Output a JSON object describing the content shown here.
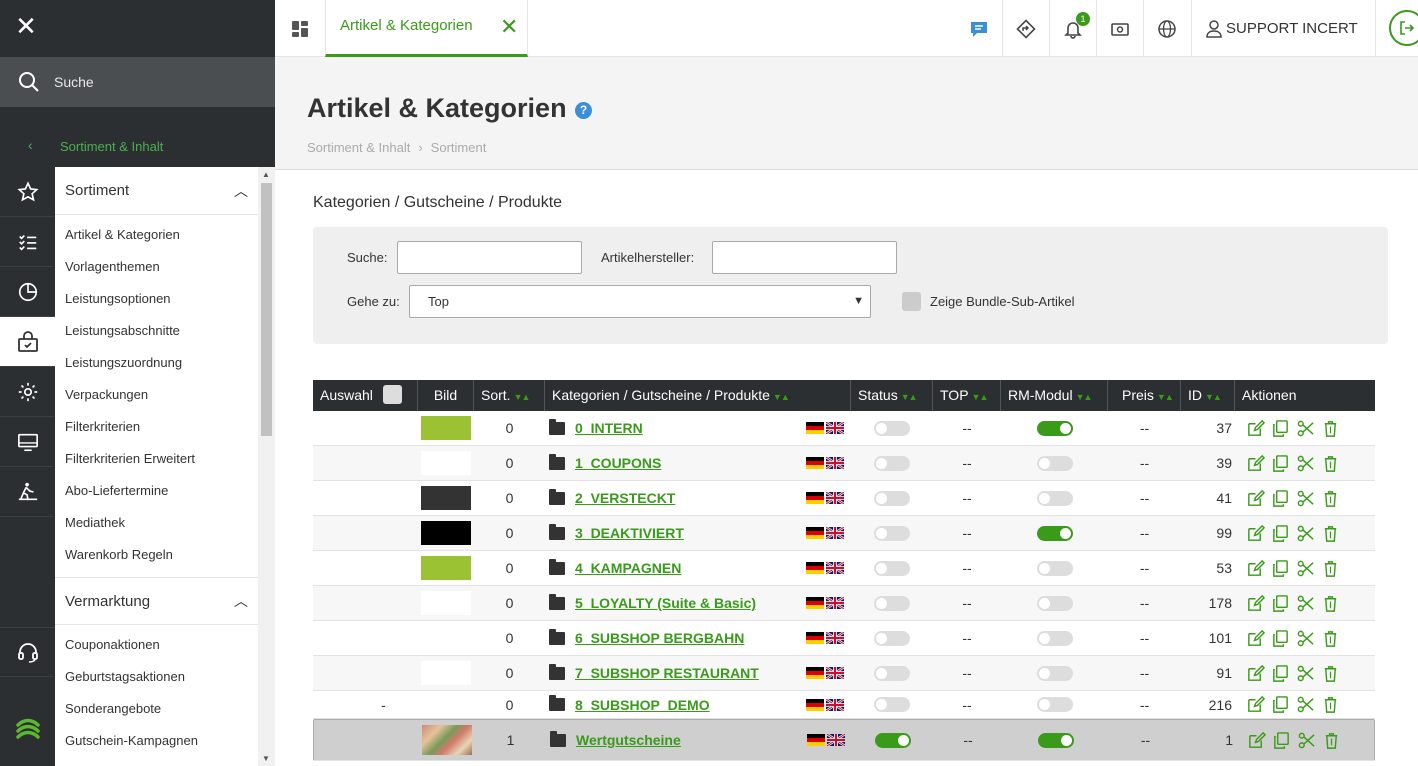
{
  "sidebar": {
    "search_label": "Suche",
    "section_label": "Sortiment & Inhalt",
    "rail_icons": [
      "star-icon",
      "checklist-icon",
      "pie-chart-icon",
      "shop-icon",
      "gear-icon",
      "monitor-icon",
      "hiker-icon",
      "headset-icon",
      "brand-logo-icon"
    ],
    "groups": [
      {
        "title": "Sortiment",
        "items": [
          "Artikel & Kategorien",
          "Vorlagenthemen",
          "Leistungsoptionen",
          "Leistungsabschnitte",
          "Leistungszuordnung",
          "Verpackungen",
          "Filterkriterien",
          "Filterkriterien Erweitert",
          "Abo-Liefertermine",
          "Mediathek",
          "Warenkorb Regeln"
        ]
      },
      {
        "title": "Vermarktung",
        "items": [
          "Couponaktionen",
          "Geburtstagsaktionen",
          "Sonderangebote",
          "Gutschein-Kampagnen"
        ]
      }
    ]
  },
  "topbar": {
    "tab_label": "Artikel & Kategorien",
    "notification_count": "1",
    "user_label": "SUPPORT INCERT"
  },
  "page": {
    "title": "Artikel & Kategorien",
    "help_glyph": "?",
    "breadcrumb": [
      "Sortiment & Inhalt",
      "Sortiment"
    ],
    "content_title": "Kategorien / Gutscheine / Produkte"
  },
  "filter": {
    "search_label": "Suche:",
    "search_value": "",
    "manufacturer_label": "Artikelhersteller:",
    "manufacturer_value": "",
    "goto_label": "Gehe zu:",
    "goto_value": "Top",
    "bundle_label": "Zeige Bundle-Sub-Artikel"
  },
  "table": {
    "headers": {
      "select": "Auswahl",
      "image": "Bild",
      "sort": "Sort.",
      "name": "Kategorien / Gutscheine / Produkte",
      "status": "Status",
      "top": "TOP",
      "rm": "RM-Modul",
      "price": "Preis",
      "id": "ID",
      "actions": "Aktionen"
    },
    "rows": [
      {
        "select": "",
        "image_color": "#9bc232",
        "sort": "0",
        "name": "0_INTERN",
        "status_on": false,
        "top": "--",
        "rm_on": true,
        "price": "--",
        "id": "37"
      },
      {
        "select": "",
        "image_color": "#ffffff",
        "sort": "0",
        "name": "1_COUPONS",
        "status_on": false,
        "top": "--",
        "rm_on": false,
        "price": "--",
        "id": "39"
      },
      {
        "select": "",
        "image_color": "#333333",
        "sort": "0",
        "name": "2_VERSTECKT",
        "status_on": false,
        "top": "--",
        "rm_on": false,
        "price": "--",
        "id": "41"
      },
      {
        "select": "",
        "image_color": "#000000",
        "sort": "0",
        "name": "3_DEAKTIVIERT",
        "status_on": false,
        "top": "--",
        "rm_on": true,
        "price": "--",
        "id": "99"
      },
      {
        "select": "",
        "image_color": "#9bc232",
        "sort": "0",
        "name": "4_KAMPAGNEN",
        "status_on": false,
        "top": "--",
        "rm_on": false,
        "price": "--",
        "id": "53"
      },
      {
        "select": "",
        "image_color": "#ffffff",
        "sort": "0",
        "name": "5_LOYALTY (Suite & Basic)",
        "status_on": false,
        "top": "--",
        "rm_on": false,
        "price": "--",
        "id": "178"
      },
      {
        "select": "",
        "image_color": "",
        "sort": "0",
        "name": "6_SUBSHOP BERGBAHN",
        "status_on": false,
        "top": "--",
        "rm_on": false,
        "price": "--",
        "id": "101"
      },
      {
        "select": "",
        "image_color": "#ffffff",
        "sort": "0",
        "name": "7_SUBSHOP RESTAURANT",
        "status_on": false,
        "top": "--",
        "rm_on": false,
        "price": "--",
        "id": "91"
      },
      {
        "select": "-",
        "image_color": "",
        "sort": "0",
        "name": "8_SUBSHOP_DEMO",
        "status_on": false,
        "top": "--",
        "rm_on": false,
        "price": "--",
        "id": "216"
      },
      {
        "select": "",
        "image_color": "photo",
        "sort": "1",
        "name": "Wertgutscheine",
        "status_on": true,
        "top": "--",
        "rm_on": true,
        "price": "--",
        "id": "1"
      }
    ]
  }
}
